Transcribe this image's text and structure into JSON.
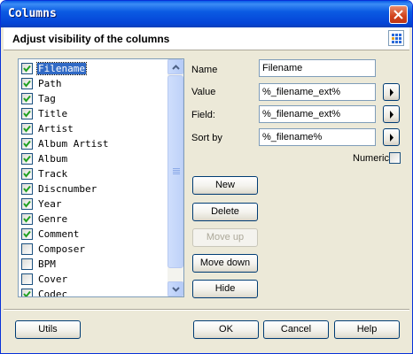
{
  "window": {
    "title": "Columns"
  },
  "header": {
    "label": "Adjust visibility of the columns",
    "icon": "grid-icon"
  },
  "columns": [
    {
      "label": "Filename",
      "checked": true
    },
    {
      "label": "Path",
      "checked": true
    },
    {
      "label": "Tag",
      "checked": true
    },
    {
      "label": "Title",
      "checked": true
    },
    {
      "label": "Artist",
      "checked": true
    },
    {
      "label": "Album Artist",
      "checked": true
    },
    {
      "label": "Album",
      "checked": true
    },
    {
      "label": "Track",
      "checked": true
    },
    {
      "label": "Discnumber",
      "checked": true
    },
    {
      "label": "Year",
      "checked": true
    },
    {
      "label": "Genre",
      "checked": true
    },
    {
      "label": "Comment",
      "checked": true
    },
    {
      "label": "Composer",
      "checked": false
    },
    {
      "label": "BPM",
      "checked": false
    },
    {
      "label": "Cover",
      "checked": false
    },
    {
      "label": "Codec",
      "checked": true
    }
  ],
  "selected_index": 0,
  "form": {
    "name_label": "Name",
    "name_value": "Filename",
    "value_label": "Value",
    "value_value": "%_filename_ext%",
    "field_label": "Field:",
    "field_value": "%_filename_ext%",
    "sortby_label": "Sort by",
    "sortby_value": "%_filename%",
    "numeric_label": "Numeric",
    "numeric_checked": false
  },
  "buttons": {
    "new": "New",
    "delete": "Delete",
    "move_up": "Move up",
    "move_down": "Move down",
    "hide": "Hide",
    "utils": "Utils",
    "ok": "OK",
    "cancel": "Cancel",
    "help": "Help"
  },
  "colors": {
    "title_blue": "#0a5ce7",
    "selection": "#316ac5",
    "check_green": "#21a121",
    "close_red": "#d1421b"
  }
}
